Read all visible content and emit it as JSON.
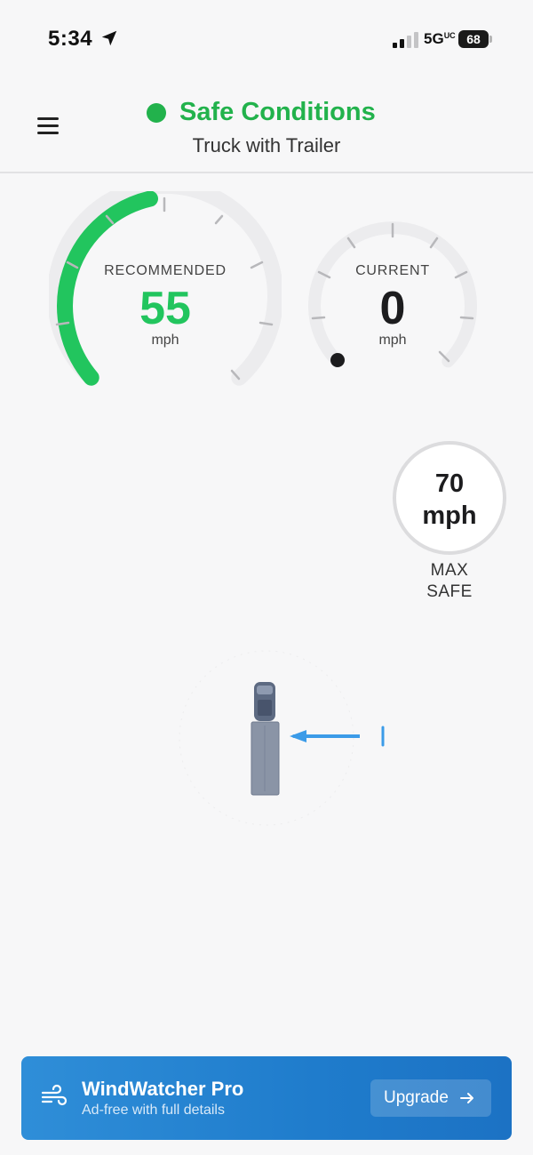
{
  "status_bar": {
    "time": "5:34",
    "network": "5G",
    "network_suffix": "UC",
    "battery": "68"
  },
  "header": {
    "status": "Safe Conditions",
    "status_color": "#22b24c",
    "vehicle": "Truck with Trailer"
  },
  "gauges": {
    "recommended": {
      "label": "RECOMMENDED",
      "value": "55",
      "unit": "mph",
      "color": "#22c55e"
    },
    "current": {
      "label": "CURRENT",
      "value": "0",
      "unit": "mph",
      "color": "#1c1c1e"
    }
  },
  "max_safe": {
    "value": "70",
    "unit": "mph",
    "label_line1": "MAX",
    "label_line2": "SAFE"
  },
  "vehicle_graphic": {
    "icon": "truck-with-trailer",
    "wind_arrow_color": "#3b9be8"
  },
  "banner": {
    "title": "WindWatcher Pro",
    "subtitle": "Ad-free with full details",
    "button": "Upgrade",
    "icon": "wind-icon",
    "background": "#1f7ccc"
  }
}
